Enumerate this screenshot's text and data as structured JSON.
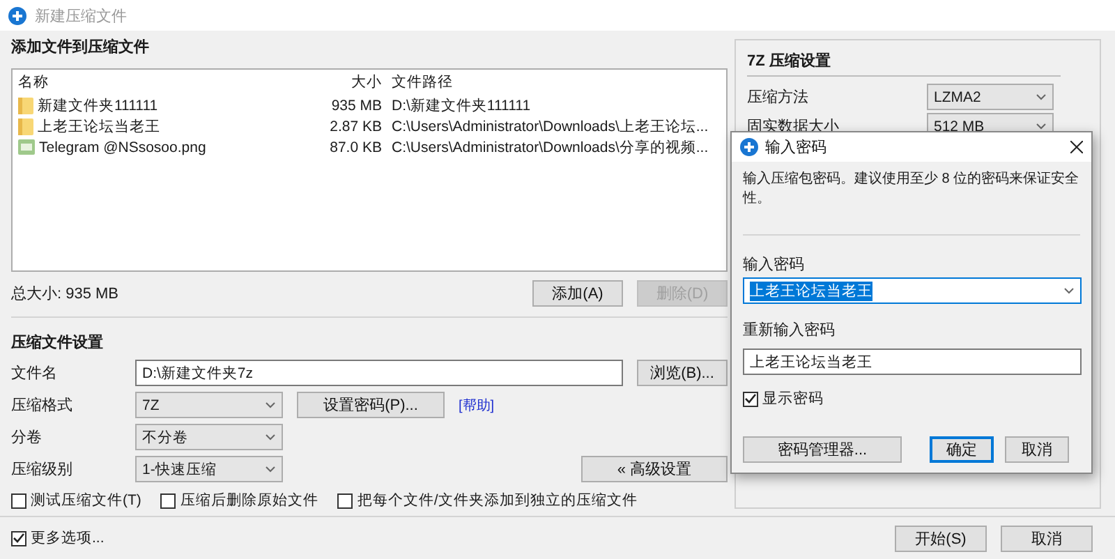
{
  "window": {
    "title": "新建压缩文件"
  },
  "files": {
    "heading": "添加文件到压缩文件",
    "columns": [
      "名称",
      "大小",
      "文件路径"
    ],
    "rows": [
      {
        "kind": "folder",
        "name": "新建文件夹111111",
        "size": "935 MB",
        "path": "D:\\新建文件夹111111"
      },
      {
        "kind": "folder",
        "name": "上老王论坛当老王",
        "size": "2.87 KB",
        "path": "C:\\Users\\Administrator\\Downloads\\上老王论坛..."
      },
      {
        "kind": "image",
        "name": "Telegram @NSsosoo.png",
        "size": "87.0 KB",
        "path": "C:\\Users\\Administrator\\Downloads\\分享的视频..."
      }
    ],
    "total": "总大小: 935 MB",
    "buttons": [
      {
        "label": "添加(A)",
        "disabled": false
      },
      {
        "label": "删除(D)",
        "disabled": true
      }
    ]
  },
  "settings": {
    "heading": "压缩文件设置",
    "fields": [
      {
        "kind": "input",
        "label": "文件名",
        "value": "D:\\新建文件夹7z",
        "button": "浏览(B)..."
      },
      {
        "kind": "select",
        "label": "压缩格式",
        "value": "7Z",
        "button": "设置密码(P)...",
        "link": "[帮助]"
      },
      {
        "kind": "select",
        "label": "分卷",
        "value": "不分卷"
      },
      {
        "kind": "select",
        "label": "压缩级别",
        "value": "1-快速压缩",
        "button": "« 高级设置"
      }
    ],
    "options": [
      {
        "label": "测试压缩文件(T)",
        "checked": false
      },
      {
        "label": "压缩后删除原始文件",
        "checked": false
      },
      {
        "label": "把每个文件/文件夹添加到独立的压缩文件",
        "checked": false
      }
    ]
  },
  "more_options": {
    "label": "更多选项...",
    "checked": true
  },
  "footer_buttons": [
    "开始(S)",
    "取消"
  ],
  "method_panel": {
    "heading": "7Z 压缩设置",
    "fields": [
      {
        "label": "压缩方法",
        "value": "LZMA2"
      },
      {
        "label": "固实数据大小",
        "value": "512 MB"
      }
    ]
  },
  "password_dialog": {
    "title": "输入密码",
    "message": "输入压缩包密码。建议使用至少 8 位的密码来保证安全性。",
    "password_label": "输入密码",
    "password_value": "上老王论坛当老王",
    "confirm_label": "重新输入密码",
    "confirm_value": "上老王论坛当老王",
    "show_password": {
      "label": "显示密码",
      "checked": true
    },
    "buttons": [
      {
        "label": "密码管理器...",
        "default": false
      },
      {
        "label": "确定",
        "default": true
      },
      {
        "label": "取消",
        "default": false
      }
    ]
  }
}
